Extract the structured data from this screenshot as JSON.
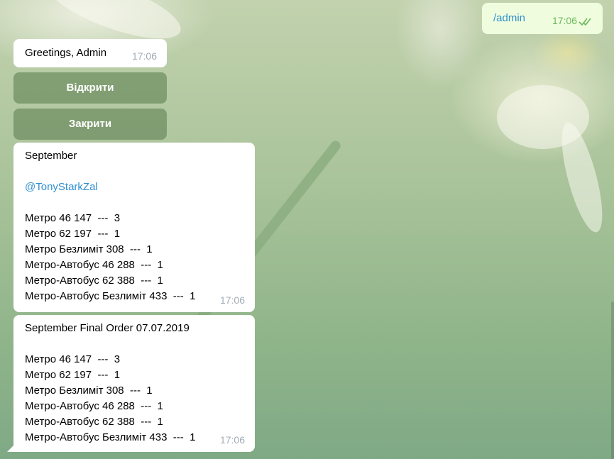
{
  "colors": {
    "bubble_in": "#ffffff",
    "bubble_out": "#effdde",
    "link": "#2f8fd0",
    "time_in": "#a0acb6",
    "time_out": "#6cb75b",
    "keyboard_button": "#6e8c5f"
  },
  "outgoing": {
    "text": "/admin",
    "time": "17:06",
    "status_icon": "double-check-icon"
  },
  "greeting": {
    "text": "Greetings, Admin",
    "time": "17:06"
  },
  "keyboard": {
    "open_label": "Відкрити",
    "close_label": "Закрити"
  },
  "report": {
    "title": "September",
    "mention": "@TonyStarkZal",
    "lines": [
      "Метро 46 147  ---  3",
      "Метро 62 197  ---  1",
      "Метро Безлиміт 308  ---  1",
      "Метро-Автобус 46 288  ---  1",
      "Метро-Автобус 62 388  ---  1",
      "Метро-Автобус Безлиміт 433  ---  1"
    ],
    "time": "17:06"
  },
  "final_order": {
    "title": "September Final Order 07.07.2019",
    "lines": [
      "Метро 46 147  ---  3",
      "Метро 62 197  ---  1",
      "Метро Безлиміт 308  ---  1",
      "Метро-Автобус 46 288  ---  1",
      "Метро-Автобус 62 388  ---  1",
      "Метро-Автобус Безлиміт 433  ---  1"
    ],
    "time": "17:06"
  }
}
